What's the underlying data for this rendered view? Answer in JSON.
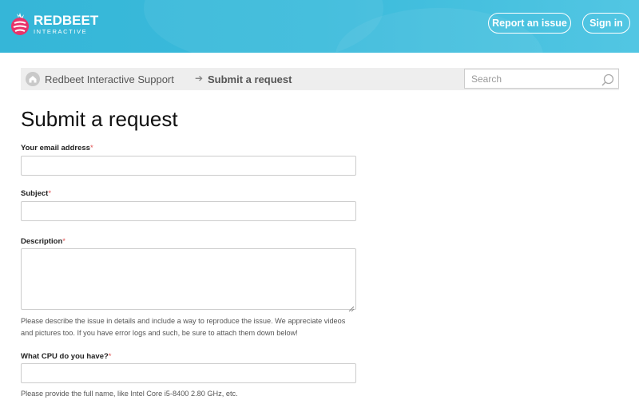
{
  "header": {
    "logo": {
      "main": "REDBEET",
      "sub": "INTERACTIVE"
    },
    "report_issue_label": "Report an issue",
    "sign_in_label": "Sign in",
    "brand_color": "#35b6d8"
  },
  "breadcrumb": {
    "home_icon": "home-icon",
    "parent": "Redbeet Interactive Support",
    "separator": "➔",
    "current": "Submit a request"
  },
  "search": {
    "placeholder": "Search",
    "icon": "search-icon"
  },
  "page": {
    "title": "Submit a request"
  },
  "form": {
    "required_marker": "*",
    "email": {
      "label": "Your email address",
      "value": ""
    },
    "subject": {
      "label": "Subject",
      "value": ""
    },
    "description": {
      "label": "Description",
      "value": "",
      "hint_line1": "Please describe the issue in details and include a way to reproduce the issue. We appreciate videos",
      "hint_line2": "and pictures too. If you have error logs and such, be sure to attach them down below!"
    },
    "cpu": {
      "label": "What CPU do you have?",
      "value": "",
      "hint": "Please provide the full name, like Intel Core i5-8400 2.80 GHz, etc."
    }
  }
}
